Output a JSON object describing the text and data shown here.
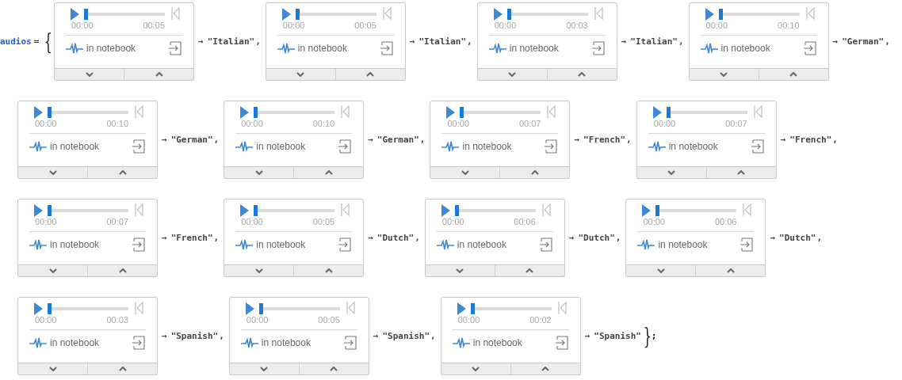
{
  "variable": "audios",
  "equals": "=",
  "open_brace": "{",
  "close_brace": "}",
  "terminator": ";",
  "rows": [
    [
      {
        "level": 0,
        "start_time": "00:00",
        "end_time": "00:05",
        "caption": "in notebook",
        "arrow": "→",
        "value": "\"Italian\"",
        "separator": ","
      },
      {
        "level": 0,
        "start_time": "00:00",
        "end_time": "00:05",
        "caption": "in notebook",
        "arrow": "→",
        "value": "\"Italian\"",
        "separator": ","
      },
      {
        "level": 0,
        "start_time": "00:00",
        "end_time": "00:03",
        "caption": "in notebook",
        "arrow": "→",
        "value": "\"Italian\"",
        "separator": ","
      },
      {
        "level": 0,
        "start_time": "00:00",
        "end_time": "00:10",
        "caption": "in notebook",
        "arrow": "→",
        "value": "\"German\"",
        "separator": ","
      }
    ],
    [
      {
        "level": 0,
        "start_time": "00:00",
        "end_time": "00:10",
        "caption": "in notebook",
        "arrow": "→",
        "value": "\"German\"",
        "separator": ","
      },
      {
        "level": 0,
        "start_time": "00:00",
        "end_time": "00:10",
        "caption": "in notebook",
        "arrow": "→",
        "value": "\"German\"",
        "separator": ","
      },
      {
        "level": 0,
        "start_time": "00:00",
        "end_time": "00:07",
        "caption": "in notebook",
        "arrow": "→",
        "value": "\"French\"",
        "separator": ","
      },
      {
        "level": 0,
        "start_time": "00:00",
        "end_time": "00:07",
        "caption": "in notebook",
        "arrow": "→",
        "value": "\"French\"",
        "separator": ","
      }
    ],
    [
      {
        "level": 0,
        "start_time": "00:00",
        "end_time": "00:07",
        "caption": "in notebook",
        "arrow": "→",
        "value": "\"French\"",
        "separator": ","
      },
      {
        "level": 0,
        "start_time": "00:00",
        "end_time": "00:05",
        "caption": "in notebook",
        "arrow": "→",
        "value": "\"Dutch\"",
        "separator": ","
      },
      {
        "level": 0,
        "start_time": "00:00",
        "end_time": "00:06",
        "caption": "in notebook",
        "arrow": "→",
        "value": "\"Dutch\"",
        "separator": ","
      },
      {
        "level": 0,
        "start_time": "00:00",
        "end_time": "00:06",
        "caption": "in notebook",
        "arrow": "→",
        "value": "\"Dutch\"",
        "separator": ","
      }
    ],
    [
      {
        "level": 0,
        "start_time": "00:00",
        "end_time": "00:03",
        "caption": "in notebook",
        "arrow": "→",
        "value": "\"Spanish\"",
        "separator": ","
      },
      {
        "level": 0,
        "start_time": "00:00",
        "end_time": "00:05",
        "caption": "in notebook",
        "arrow": "→",
        "value": "\"Spanish\"",
        "separator": ","
      },
      {
        "level": 0,
        "start_time": "00:00",
        "end_time": "00:02",
        "caption": "in notebook",
        "arrow": "→",
        "value": "\"Spanish\""
      }
    ]
  ]
}
